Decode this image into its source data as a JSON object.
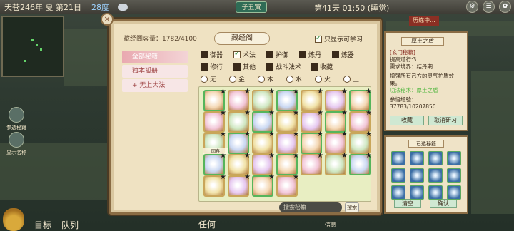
{
  "topbar": {
    "date": "天苍246年 夏 第21日",
    "temperature": "28度",
    "shichen": "子丑寅",
    "time": "第41天 01:50 (睡觉)",
    "history_tag": "历练中..."
  },
  "left_menu": {
    "btn1": "参透秘籍",
    "btn2": "显示名称",
    "nav_target": "目标",
    "nav_team": "队列",
    "mission": "任何",
    "info": "信息"
  },
  "library": {
    "volume_label": "藏经阁容量：",
    "volume_value": "1782/4100",
    "title": "藏经阁",
    "only_learnable": "只显示可学习",
    "tabs": [
      "全部秘籍",
      "独本孤册",
      "无上大法"
    ],
    "filter_row1": [
      "御器",
      "术法",
      "护御",
      "炼丹",
      "炼器"
    ],
    "filter_row2": [
      "修行",
      "其他",
      "战斗法术",
      "收藏"
    ],
    "elements": [
      "无",
      "金",
      "木",
      "水",
      "火",
      "土"
    ],
    "search_placeholder": "搜索秘籍",
    "search_btn": "搜索",
    "grid_labels": [
      [
        "",
        "",
        "",
        "",
        "",
        "",
        ""
      ],
      [
        "",
        "",
        "",
        "",
        "",
        "",
        ""
      ],
      [
        "回春",
        "",
        "",
        "",
        "",
        "",
        ""
      ],
      [
        "",
        "",
        "",
        "",
        "",
        "",
        ""
      ],
      [
        "",
        "",
        "",
        ""
      ]
    ]
  },
  "detail": {
    "name": "厚土之盾",
    "line1": "[玄门秘籍]",
    "line2": "提高道行:3",
    "line3": "需求境界：结丹期",
    "desc": "增强所有己方的灵气护盾效果。",
    "extra": "功法秘术：厚土之盾",
    "exp_label": "参悟经验：",
    "exp_value": "37783/10207850",
    "btn_fav": "收藏",
    "btn_cancel": "取消研习"
  },
  "chosen": {
    "title": "已选秘籍",
    "btn_clear": "清空",
    "btn_ok": "确认"
  },
  "colors": {
    "panel": "#efe2c2",
    "frame": "#8a6c44",
    "grid_bg": "#e8eec2",
    "tab_active": "#e9a9b0"
  }
}
